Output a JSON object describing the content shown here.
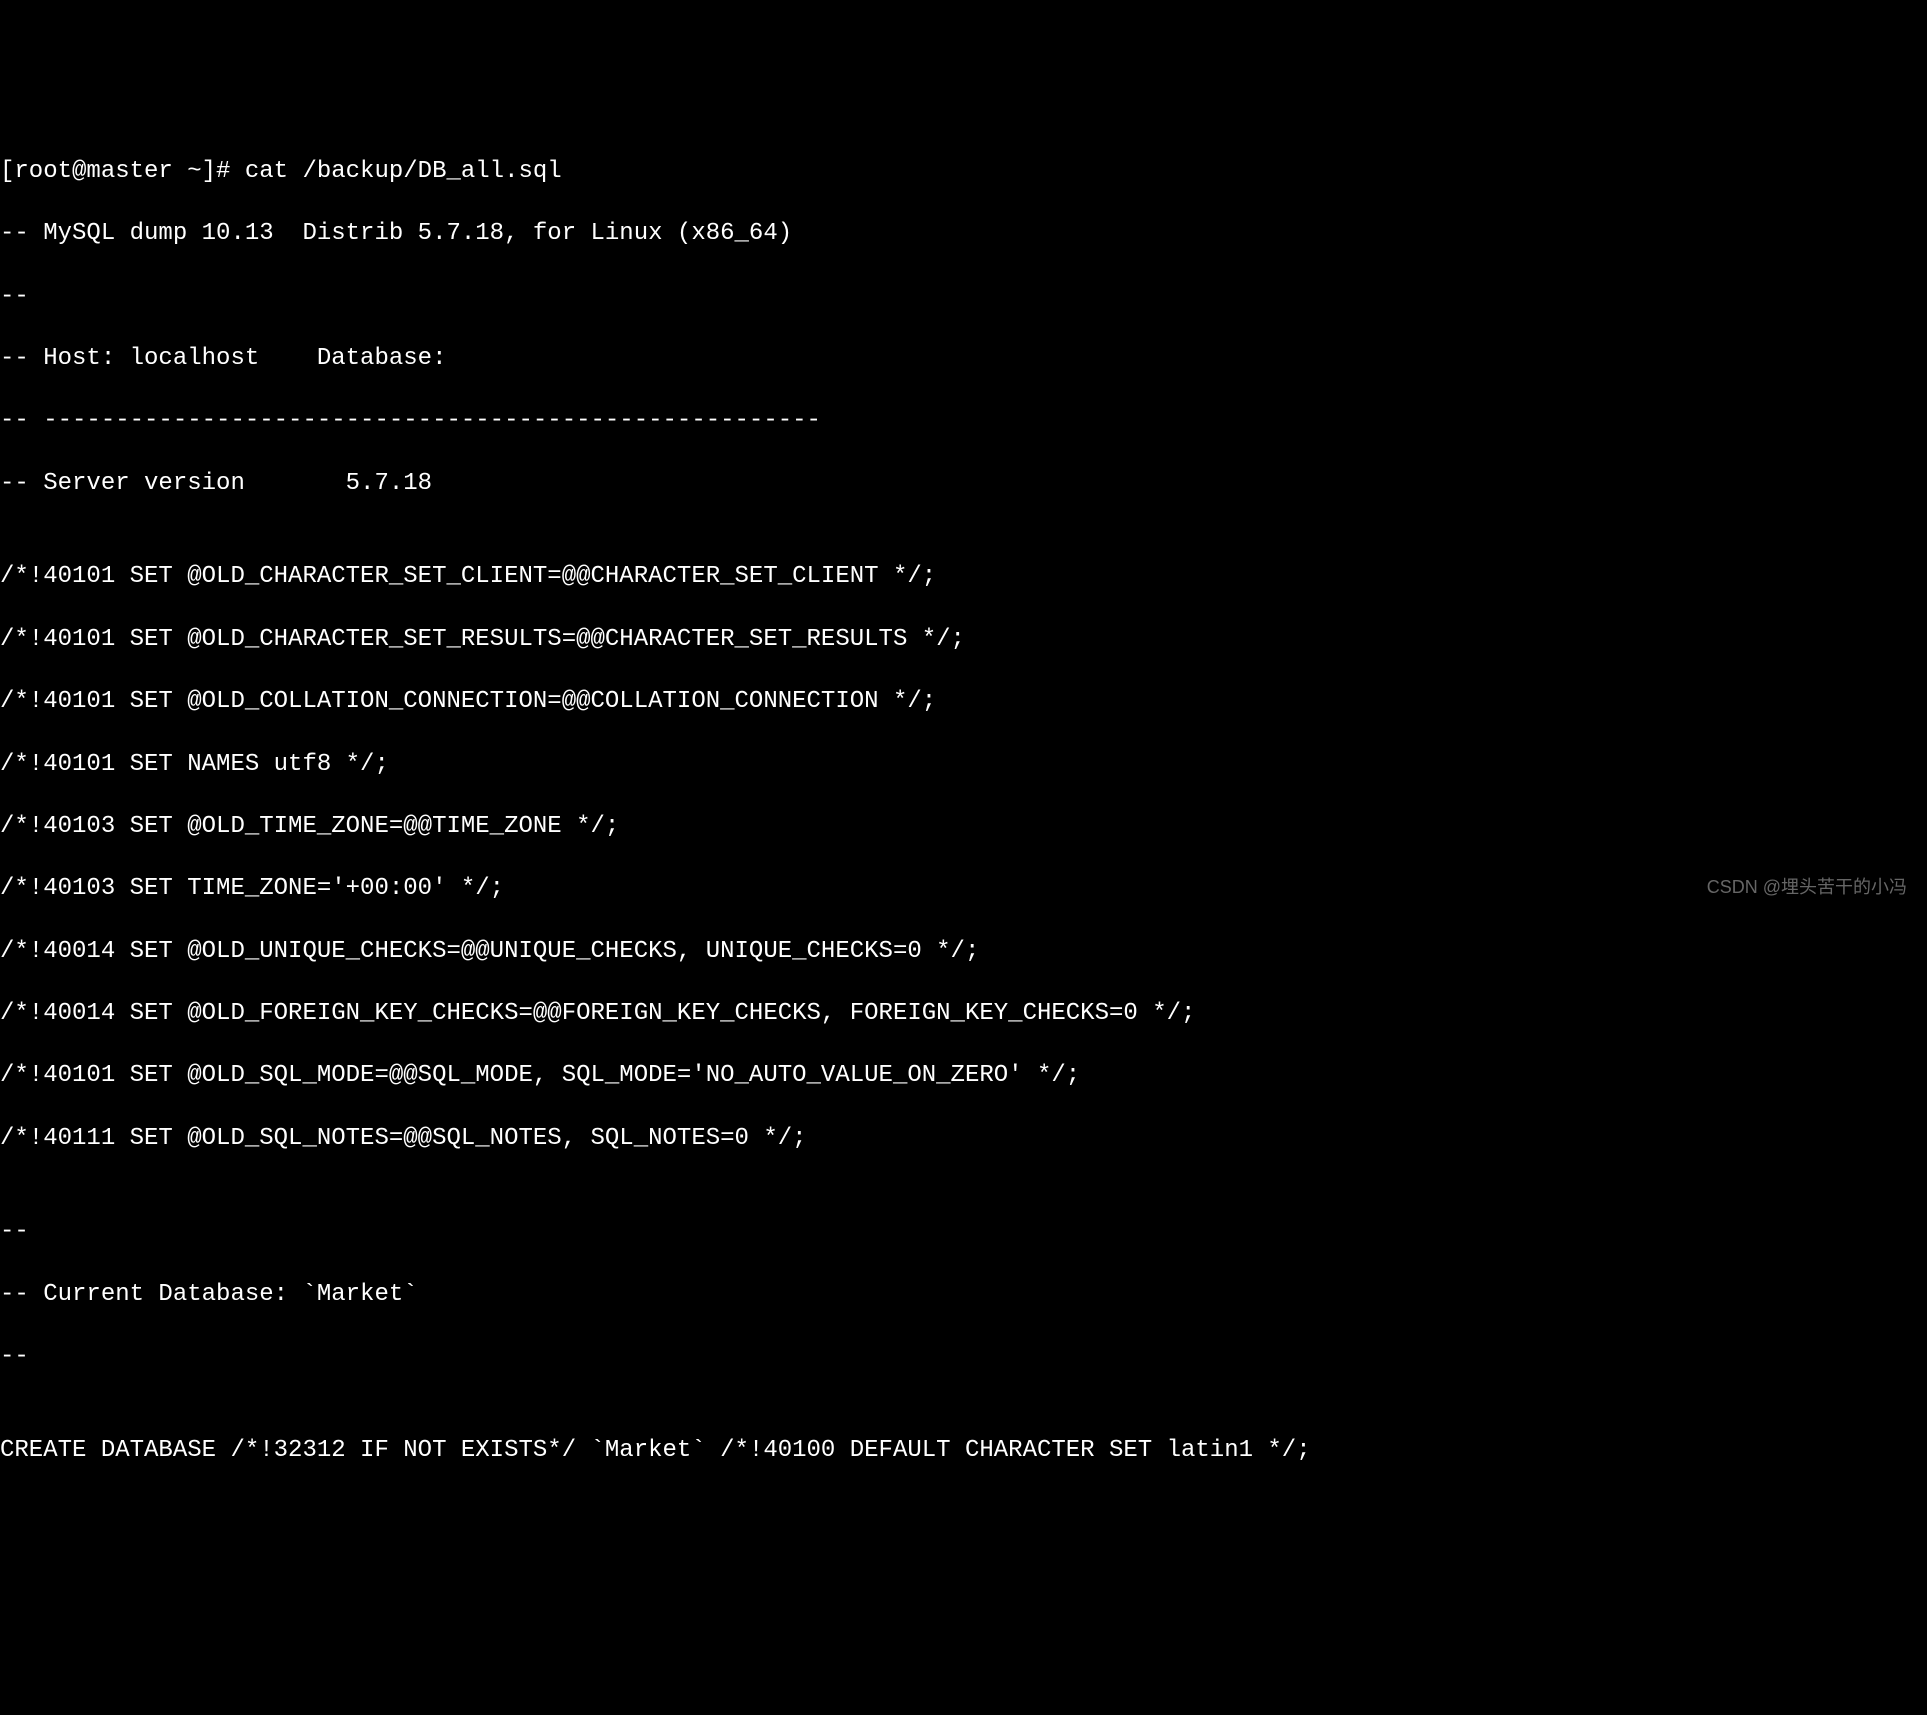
{
  "terminal": {
    "lines": [
      "[root@master ~]# cat /backup/DB_all.sql",
      "-- MySQL dump 10.13  Distrib 5.7.18, for Linux (x86_64)",
      "--",
      "-- Host: localhost    Database:",
      "-- ------------------------------------------------------",
      "-- Server version       5.7.18",
      "",
      "/*!40101 SET @OLD_CHARACTER_SET_CLIENT=@@CHARACTER_SET_CLIENT */;",
      "/*!40101 SET @OLD_CHARACTER_SET_RESULTS=@@CHARACTER_SET_RESULTS */;",
      "/*!40101 SET @OLD_COLLATION_CONNECTION=@@COLLATION_CONNECTION */;",
      "/*!40101 SET NAMES utf8 */;",
      "/*!40103 SET @OLD_TIME_ZONE=@@TIME_ZONE */;",
      "/*!40103 SET TIME_ZONE='+00:00' */;",
      "/*!40014 SET @OLD_UNIQUE_CHECKS=@@UNIQUE_CHECKS, UNIQUE_CHECKS=0 */;",
      "/*!40014 SET @OLD_FOREIGN_KEY_CHECKS=@@FOREIGN_KEY_CHECKS, FOREIGN_KEY_CHECKS=0 */;",
      "/*!40101 SET @OLD_SQL_MODE=@@SQL_MODE, SQL_MODE='NO_AUTO_VALUE_ON_ZERO' */;",
      "/*!40111 SET @OLD_SQL_NOTES=@@SQL_NOTES, SQL_NOTES=0 */;",
      "",
      "--",
      "-- Current Database: `Market`",
      "--",
      "",
      "CREATE DATABASE /*!32312 IF NOT EXISTS*/ `Market` /*!40100 DEFAULT CHARACTER SET latin1 */;"
    ]
  },
  "watermark": "CSDN @埋头苦干的小冯"
}
